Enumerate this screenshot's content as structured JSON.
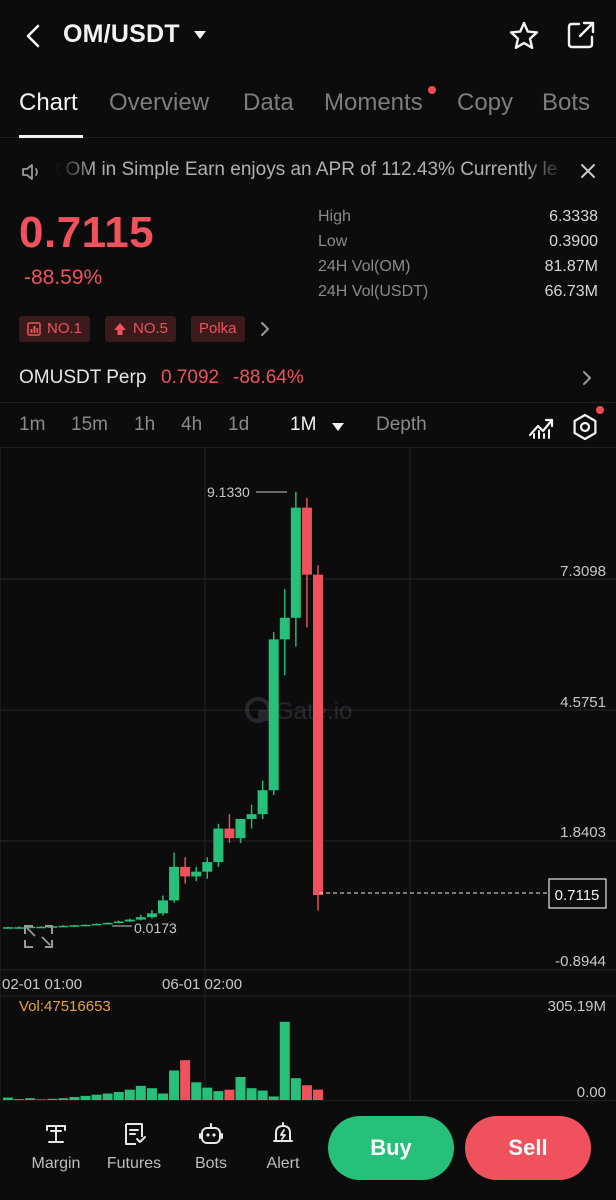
{
  "header": {
    "pair": "OM/USDT"
  },
  "tabs": [
    {
      "label": "Chart"
    },
    {
      "label": "Overview"
    },
    {
      "label": "Data"
    },
    {
      "label": "Moments"
    },
    {
      "label": "Copy"
    },
    {
      "label": "Bots"
    }
  ],
  "announcement": {
    "text": "t OM in Simple Earn enjoys an APR of 112.43%   Currently le"
  },
  "ticker": {
    "price": "0.7115",
    "change": "-88.59%",
    "stats": [
      {
        "label": "High",
        "value": "6.3338"
      },
      {
        "label": "Low",
        "value": "0.3900"
      },
      {
        "label": "24H Vol(OM)",
        "value": "81.87M"
      },
      {
        "label": "24H Vol(USDT)",
        "value": "66.73M"
      }
    ]
  },
  "badges": [
    {
      "label": "NO.1",
      "icon": "ranking-icon"
    },
    {
      "label": "NO.5",
      "icon": "arrow-up-icon"
    },
    {
      "label": "Polka",
      "icon": ""
    }
  ],
  "perp": {
    "name": "OMUSDT Perp",
    "price": "0.7092",
    "change": "-88.64%"
  },
  "timeframes": [
    {
      "label": "1m"
    },
    {
      "label": "15m"
    },
    {
      "label": "1h"
    },
    {
      "label": "4h"
    },
    {
      "label": "1d"
    },
    {
      "label": "1M"
    },
    {
      "label": "Depth"
    }
  ],
  "colors": {
    "up": "#27c07a",
    "down": "#f0525d",
    "accent_orange": "#e8a33c"
  },
  "chart_data": {
    "type": "candlestick",
    "watermark": "Gate.io",
    "y_axis_labels": [
      "7.3098",
      "4.5751",
      "1.8403",
      "-0.8944"
    ],
    "x_axis_labels": [
      "02-01 01:00",
      "06-01 02:00"
    ],
    "current_price_label": "0.7115",
    "high_marker": "9.1330",
    "low_marker": "0.0173",
    "candles": [
      {
        "o": 0.03,
        "h": 0.05,
        "l": 0.02,
        "c": 0.04
      },
      {
        "o": 0.04,
        "h": 0.06,
        "l": 0.03,
        "c": 0.04
      },
      {
        "o": 0.04,
        "h": 0.05,
        "l": 0.03,
        "c": 0.05
      },
      {
        "o": 0.05,
        "h": 0.06,
        "l": 0.04,
        "c": 0.05
      },
      {
        "o": 0.05,
        "h": 0.07,
        "l": 0.04,
        "c": 0.06
      },
      {
        "o": 0.06,
        "h": 0.08,
        "l": 0.05,
        "c": 0.07
      },
      {
        "o": 0.07,
        "h": 0.09,
        "l": 0.06,
        "c": 0.08
      },
      {
        "o": 0.08,
        "h": 0.1,
        "l": 0.07,
        "c": 0.09
      },
      {
        "o": 0.09,
        "h": 0.12,
        "l": 0.08,
        "c": 0.11
      },
      {
        "o": 0.11,
        "h": 0.14,
        "l": 0.1,
        "c": 0.13
      },
      {
        "o": 0.13,
        "h": 0.18,
        "l": 0.12,
        "c": 0.16
      },
      {
        "o": 0.16,
        "h": 0.22,
        "l": 0.15,
        "c": 0.2
      },
      {
        "o": 0.2,
        "h": 0.3,
        "l": 0.18,
        "c": 0.25
      },
      {
        "o": 0.25,
        "h": 0.4,
        "l": 0.22,
        "c": 0.33
      },
      {
        "o": 0.33,
        "h": 0.7,
        "l": 0.28,
        "c": 0.6
      },
      {
        "o": 0.6,
        "h": 1.6,
        "l": 0.55,
        "c": 1.3
      },
      {
        "o": 1.3,
        "h": 1.5,
        "l": 0.95,
        "c": 1.1
      },
      {
        "o": 1.1,
        "h": 1.3,
        "l": 1.0,
        "c": 1.2
      },
      {
        "o": 1.2,
        "h": 1.5,
        "l": 1.05,
        "c": 1.4
      },
      {
        "o": 1.4,
        "h": 2.2,
        "l": 1.3,
        "c": 2.1
      },
      {
        "o": 2.1,
        "h": 2.4,
        "l": 1.8,
        "c": 1.9
      },
      {
        "o": 1.9,
        "h": 2.3,
        "l": 1.8,
        "c": 2.3
      },
      {
        "o": 2.3,
        "h": 2.6,
        "l": 2.1,
        "c": 2.4
      },
      {
        "o": 2.4,
        "h": 3.1,
        "l": 2.3,
        "c": 2.9
      },
      {
        "o": 2.9,
        "h": 6.2,
        "l": 2.8,
        "c": 6.05
      },
      {
        "o": 6.05,
        "h": 7.1,
        "l": 5.3,
        "c": 6.5
      },
      {
        "o": 6.5,
        "h": 9.13,
        "l": 5.9,
        "c": 8.8
      },
      {
        "o": 8.8,
        "h": 9.0,
        "l": 6.3,
        "c": 7.4
      },
      {
        "o": 7.4,
        "h": 7.6,
        "l": 0.39,
        "c": 0.7115
      }
    ],
    "volume": {
      "label": "Vol:47516653",
      "max_label": "305.19M",
      "min_label": "0.00",
      "values": [
        8,
        3,
        6,
        2,
        4,
        6,
        10,
        14,
        18,
        22,
        27,
        35,
        48,
        40,
        22,
        100,
        135,
        60,
        42,
        30,
        35,
        78,
        40,
        32,
        12,
        265,
        74,
        50,
        35
      ]
    }
  },
  "bottom_nav": [
    {
      "label": "Margin",
      "icon": "margin-icon"
    },
    {
      "label": "Futures",
      "icon": "futures-icon"
    },
    {
      "label": "Bots",
      "icon": "bots-icon"
    },
    {
      "label": "Alert",
      "icon": "alert-icon"
    }
  ],
  "actions": {
    "buy": "Buy",
    "sell": "Sell"
  }
}
